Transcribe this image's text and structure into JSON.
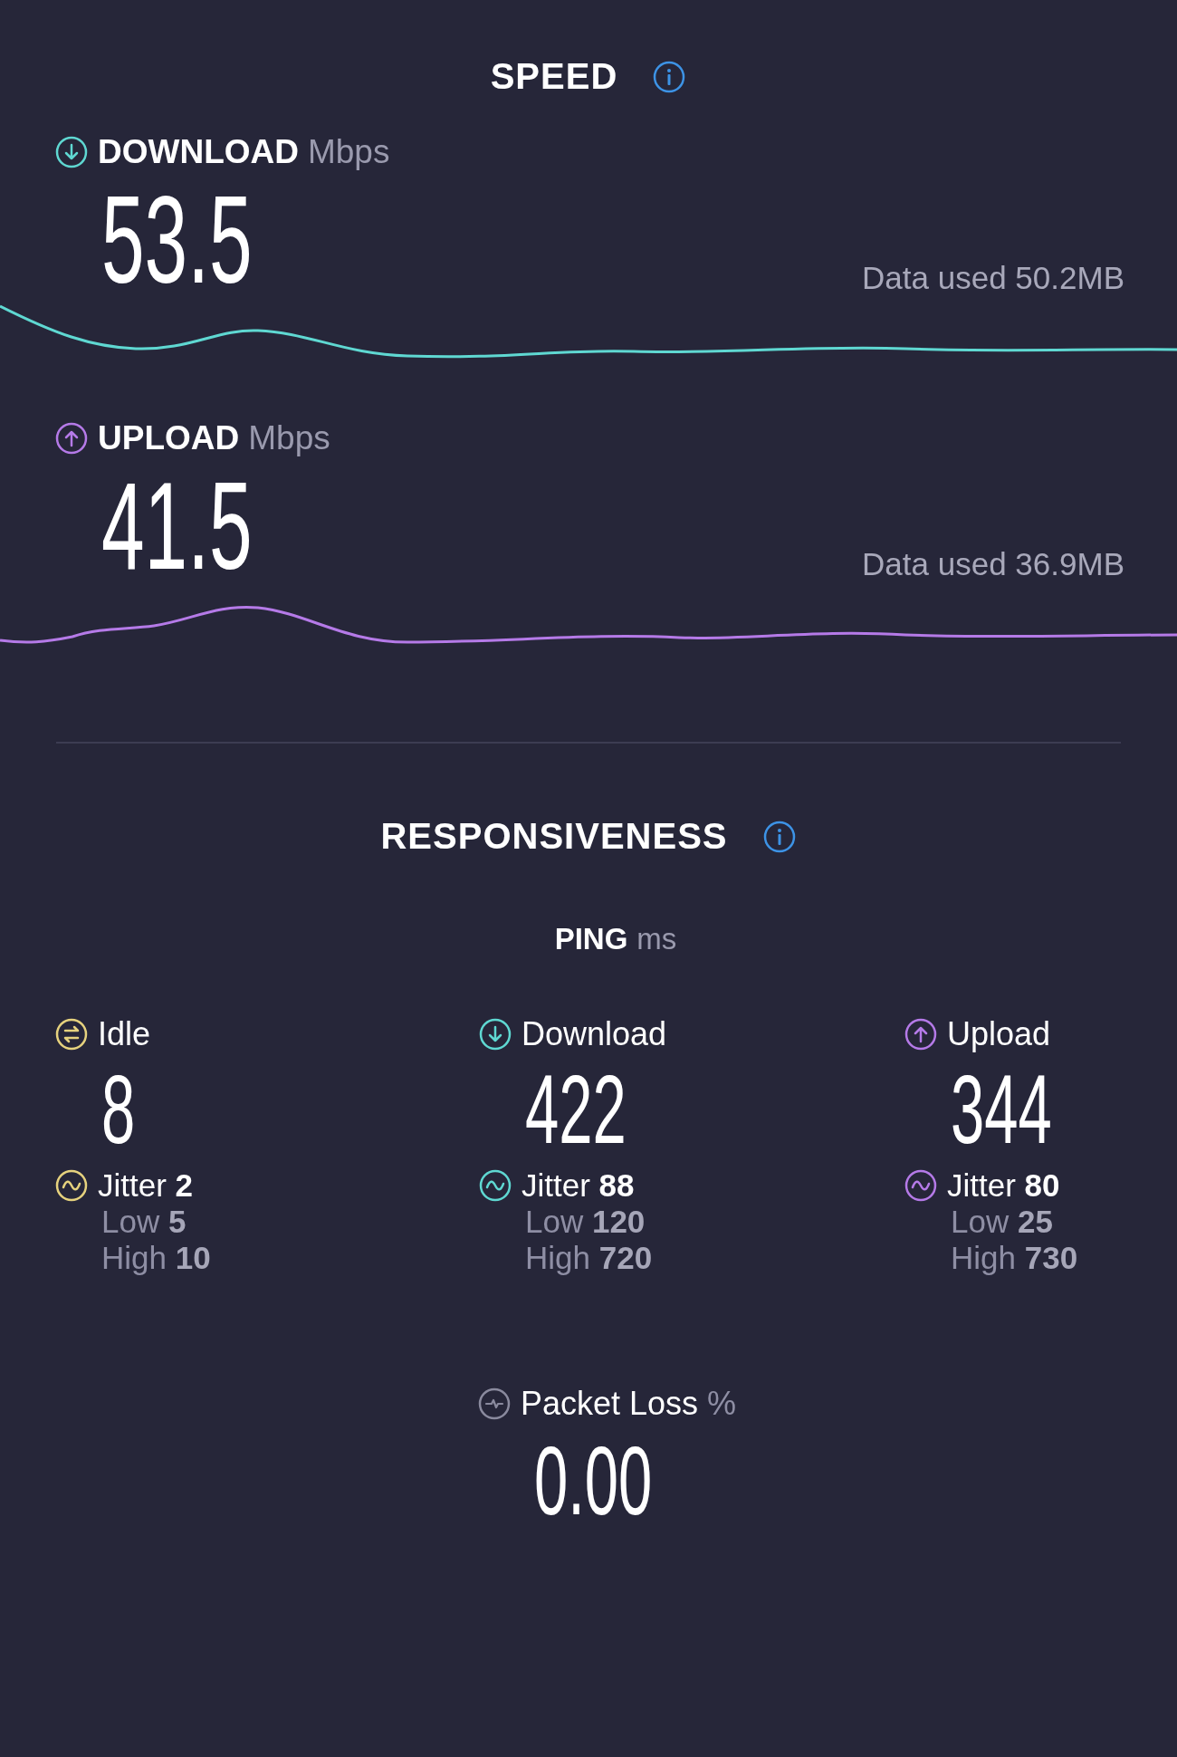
{
  "speed": {
    "title": "SPEED",
    "sections": [
      {
        "kind": "download",
        "label": "DOWNLOAD",
        "unit": "Mbps",
        "value": "53.5",
        "data_used": "Data used 50.2MB",
        "color": "#5fd8d2"
      },
      {
        "kind": "upload",
        "label": "UPLOAD",
        "unit": "Mbps",
        "value": "41.5",
        "data_used": "Data used 36.9MB",
        "color": "#b57ae8"
      }
    ]
  },
  "responsiveness": {
    "title": "RESPONSIVENESS",
    "ping": {
      "label": "PING",
      "unit": "ms",
      "columns": [
        {
          "kind": "idle",
          "label": "Idle",
          "value": "8",
          "color": "#e6d27e",
          "jitter_label": "Jitter",
          "jitter": "2",
          "low_label": "Low",
          "low": "5",
          "high_label": "High",
          "high": "10"
        },
        {
          "kind": "download",
          "label": "Download",
          "value": "422",
          "color": "#5fd8d2",
          "jitter_label": "Jitter",
          "jitter": "88",
          "low_label": "Low",
          "low": "120",
          "high_label": "High",
          "high": "720"
        },
        {
          "kind": "upload",
          "label": "Upload",
          "value": "344",
          "color": "#b57ae8",
          "jitter_label": "Jitter",
          "jitter": "80",
          "low_label": "Low",
          "low": "25",
          "high_label": "High",
          "high": "730"
        }
      ]
    }
  },
  "packet_loss": {
    "label": "Packet Loss",
    "unit": "%",
    "value": "0.00"
  }
}
